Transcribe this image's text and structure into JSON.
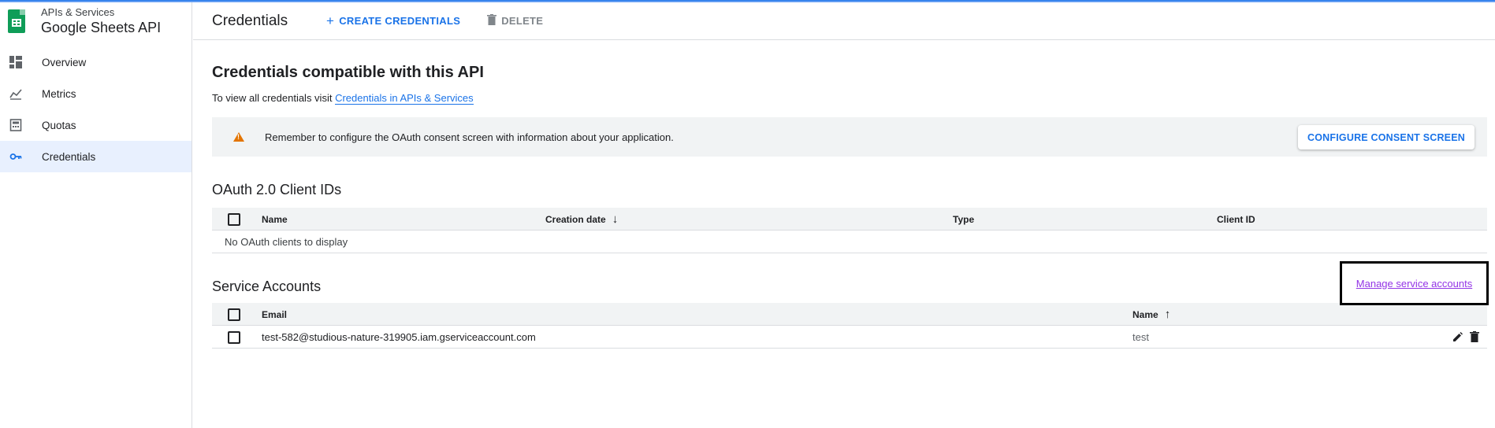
{
  "app": {
    "subtitle": "APIs & Services",
    "title": "Google Sheets API"
  },
  "sidebar": {
    "items": [
      {
        "label": "Overview",
        "icon": "dashboard-icon"
      },
      {
        "label": "Metrics",
        "icon": "chart-icon"
      },
      {
        "label": "Quotas",
        "icon": "calculator-icon"
      },
      {
        "label": "Credentials",
        "icon": "key-icon",
        "active": true
      }
    ]
  },
  "header": {
    "title": "Credentials",
    "create_label": "CREATE CREDENTIALS",
    "delete_label": "DELETE"
  },
  "main": {
    "heading": "Credentials compatible with this API",
    "viewall_prefix": "To view all credentials visit",
    "viewall_link": "Credentials in APIs & Services",
    "banner_text": "Remember to configure the OAuth consent screen with information about your application.",
    "consent_button": "CONFIGURE CONSENT SCREEN"
  },
  "oauth": {
    "title": "OAuth 2.0 Client IDs",
    "columns": [
      "Name",
      "Creation date",
      "Type",
      "Client ID"
    ],
    "empty_text": "No OAuth clients to display"
  },
  "service_accounts": {
    "title": "Service Accounts",
    "manage_link": "Manage service accounts",
    "columns": [
      "Email",
      "Name"
    ],
    "rows": [
      {
        "email": "test-582@studious-nature-319905.iam.gserviceaccount.com",
        "name": "test"
      }
    ]
  },
  "colors": {
    "accent": "#1a73e8",
    "warning": "#e37400",
    "visited_link": "#9334e6"
  }
}
